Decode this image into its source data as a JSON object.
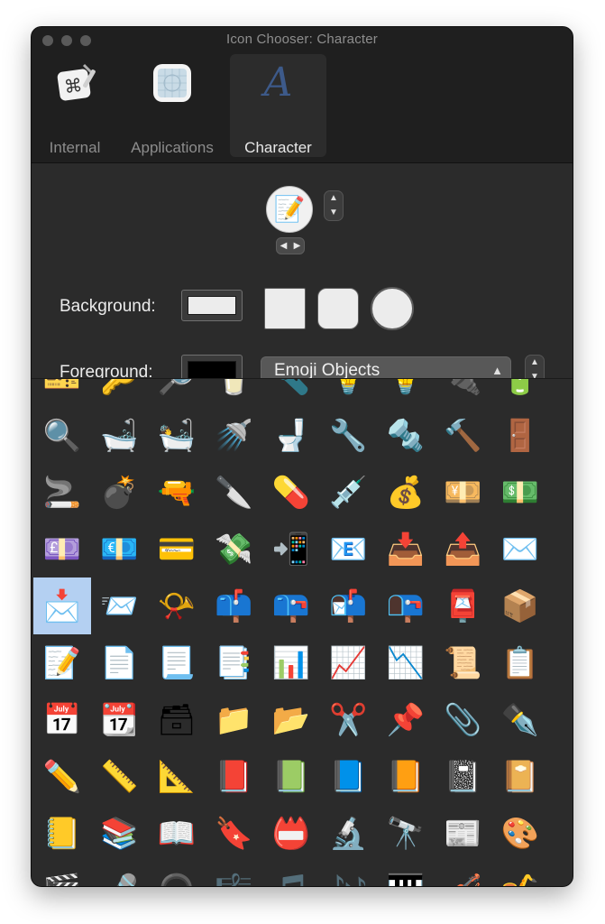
{
  "window": {
    "title": "Icon Chooser: Character"
  },
  "tabs": [
    {
      "label": "Internal",
      "icon": "keyboard-shortcut-icon"
    },
    {
      "label": "Applications",
      "icon": "blueprint-icon"
    },
    {
      "label": "Character",
      "icon": "letter-a-icon",
      "glyph": "A",
      "active": true
    }
  ],
  "preview": {
    "glyph": "📝"
  },
  "background": {
    "label": "Background:",
    "color": "#ececec",
    "shapes": [
      "square",
      "rounded-square",
      "circle"
    ]
  },
  "foreground": {
    "label": "Foreground:",
    "color": "#000000"
  },
  "category": {
    "selected": "Emoji Objects"
  },
  "grid": {
    "selected_row": 4,
    "selected_col": 0,
    "rows": [
      [
        "🎫",
        "🔑",
        "🔎",
        "🥛",
        "🔦",
        "💡",
        "💡",
        "🔌",
        "🔋"
      ],
      [
        "🔍",
        "🛁",
        "🛀",
        "🚿",
        "🚽",
        "🔧",
        "🔩",
        "🔨",
        "🚪"
      ],
      [
        "🚬",
        "💣",
        "🔫",
        "🔪",
        "💊",
        "💉",
        "💰",
        "💴",
        "💵"
      ],
      [
        "💷",
        "💶",
        "💳",
        "💸",
        "📲",
        "📧",
        "📥",
        "📤",
        "✉️"
      ],
      [
        "📩",
        "📨",
        "📯",
        "📫",
        "📪",
        "📬",
        "📭",
        "📮",
        "📦"
      ],
      [
        "📝",
        "📄",
        "📃",
        "📑",
        "📊",
        "📈",
        "📉",
        "📜",
        "📋"
      ],
      [
        "📅",
        "📆",
        "🗃",
        "📁",
        "📂",
        "✂️",
        "📌",
        "📎",
        "✒️"
      ],
      [
        "✏️",
        "📏",
        "📐",
        "📕",
        "📗",
        "📘",
        "📙",
        "📓",
        "📔"
      ],
      [
        "📒",
        "📚",
        "📖",
        "🔖",
        "📛",
        "🔬",
        "🔭",
        "📰",
        "🎨"
      ],
      [
        "🎬",
        "🎤",
        "🎧",
        "🎼",
        "🎵",
        "🎶",
        "🎹",
        "🎻",
        "🎷"
      ]
    ]
  }
}
